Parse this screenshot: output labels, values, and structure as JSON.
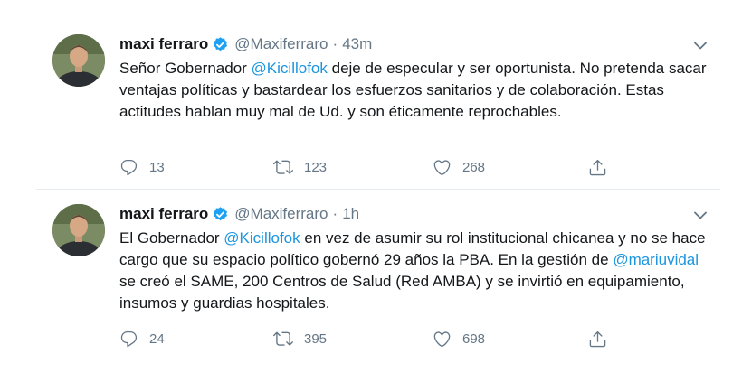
{
  "tweets": [
    {
      "name": "maxi ferraro",
      "handle": "@Maxiferraro",
      "separator": "·",
      "time": "43m",
      "text": [
        {
          "t": "Señor Gobernador ",
          "mention": false
        },
        {
          "t": "@Kicillofok",
          "mention": true
        },
        {
          "t": " deje de especular y ser oportunista. No pretenda sacar ventajas políticas y bastardear los esfuerzos sanitarios y de colaboración. Estas actitudes hablan muy mal de Ud. y son éticamente reprochables.",
          "mention": false
        }
      ],
      "replies": "13",
      "retweets": "123",
      "likes": "268"
    },
    {
      "name": "maxi ferraro",
      "handle": "@Maxiferraro",
      "separator": "·",
      "time": "1h",
      "text": [
        {
          "t": "El Gobernador ",
          "mention": false
        },
        {
          "t": "@Kicillofok",
          "mention": true
        },
        {
          "t": " en vez de asumir su rol institucional chicanea y no se hace cargo que su espacio político gobernó 29 años la PBA. En la gestión de ",
          "mention": false
        },
        {
          "t": "@mariuvidal",
          "mention": true
        },
        {
          "t": " se creó el SAME, 200 Centros de Salud (Red AMBA) y se invirtió en equipamiento, insumos y guardias hospitales.",
          "mention": false
        }
      ],
      "replies": "24",
      "retweets": "395",
      "likes": "698"
    }
  ],
  "icons": {
    "verified": "verified-badge-icon",
    "caret": "chevron-down-icon",
    "reply": "reply-icon",
    "retweet": "retweet-icon",
    "like": "heart-icon",
    "share": "share-icon"
  },
  "colors": {
    "mention": "#1b95e0",
    "verified": "#1da1f2",
    "secondary_text": "#657786"
  }
}
